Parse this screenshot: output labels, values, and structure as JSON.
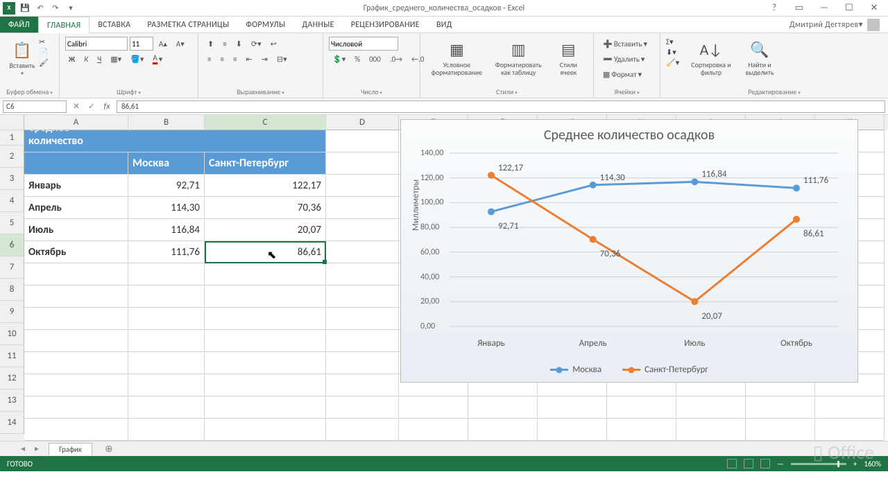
{
  "app": {
    "title": "График_среднего_количества_осадков - Excel",
    "user": "Дмитрий Дегтярев"
  },
  "qa": {
    "save": "💾",
    "undo": "↶",
    "redo": "↷"
  },
  "tabs": {
    "file": "ФАЙЛ",
    "home": "ГЛАВНАЯ",
    "insert": "ВСТАВКА",
    "layout": "РАЗМЕТКА СТРАНИЦЫ",
    "formulas": "ФОРМУЛЫ",
    "data": "ДАННЫЕ",
    "review": "РЕЦЕНЗИРОВАНИЕ",
    "view": "ВИД"
  },
  "ribbon": {
    "clipboard": {
      "paste": "Вставить",
      "label": "Буфер обмена"
    },
    "font": {
      "name": "Calibri",
      "size": "11",
      "label": "Шрифт"
    },
    "align": {
      "label": "Выравнивание"
    },
    "number": {
      "fmt": "Числовой",
      "label": "Число"
    },
    "styles": {
      "cond": "Условное форматирование",
      "table": "Форматировать как таблицу",
      "cell": "Стили ячеек",
      "label": "Стили"
    },
    "cells": {
      "ins": "Вставить",
      "del": "Удалить",
      "fmt": "Формат",
      "label": "Ячейки"
    },
    "edit": {
      "sort": "Сортировка и фильтр",
      "find": "Найти и выделить",
      "label": "Редактирование"
    }
  },
  "formula": {
    "ref": "C6",
    "val": "86,61"
  },
  "cols": [
    "A",
    "B",
    "C",
    "D",
    "E",
    "F",
    "G",
    "H",
    "I",
    "J",
    "K"
  ],
  "rows": [
    "1",
    "2",
    "3",
    "4",
    "5",
    "6",
    "7",
    "8",
    "9",
    "10",
    "11",
    "12",
    "13",
    "14"
  ],
  "table": {
    "title": "Среднее количество осадков",
    "h1": "Москва",
    "h2": "Санкт-Петербург",
    "r": [
      {
        "m": "Январь",
        "a": "92,71",
        "b": "122,17"
      },
      {
        "m": "Апрель",
        "a": "114,30",
        "b": "70,36"
      },
      {
        "m": "Июль",
        "a": "116,84",
        "b": "20,07"
      },
      {
        "m": "Октябрь",
        "a": "111,76",
        "b": "86,61"
      }
    ]
  },
  "chart_data": {
    "type": "line",
    "title": "Среднее количество осадков",
    "ylabel": "Миллиметры",
    "categories": [
      "Январь",
      "Апрель",
      "Июль",
      "Октябрь"
    ],
    "series": [
      {
        "name": "Москва",
        "color": "#5b9bd5",
        "values": [
          92.71,
          114.3,
          116.84,
          111.76
        ]
      },
      {
        "name": "Санкт-Петербург",
        "color": "#ed7d31",
        "values": [
          122.17,
          70.36,
          20.07,
          86.61
        ]
      }
    ],
    "ylim": [
      0,
      140
    ],
    "yticks": [
      0,
      20,
      40,
      60,
      80,
      100,
      120,
      140
    ],
    "ytick_labels": [
      "0,00",
      "20,00",
      "40,00",
      "60,00",
      "80,00",
      "100,00",
      "120,00",
      "140,00"
    ],
    "data_labels": [
      [
        "92,71",
        "114,30",
        "116,84",
        "111,76"
      ],
      [
        "122,17",
        "70,36",
        "20,07",
        "86,61"
      ]
    ]
  },
  "sheet": {
    "name": "График"
  },
  "status": {
    "ready": "ГОТОВО",
    "zoom": "160%"
  },
  "wm": "Office"
}
